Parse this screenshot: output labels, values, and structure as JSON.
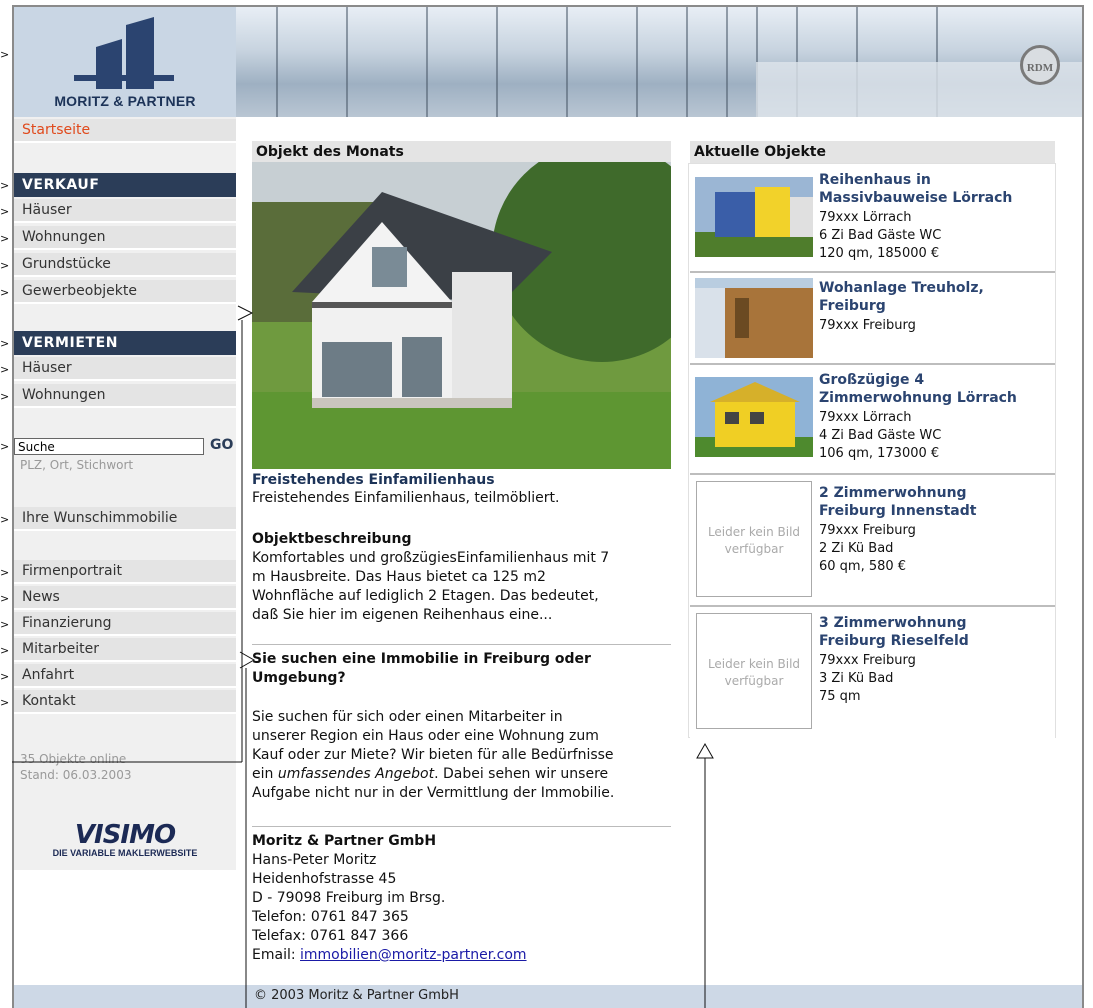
{
  "header": {
    "logo_text": "MORITZ & PARTNER",
    "badge_text": "RDM"
  },
  "sidebar": {
    "start": "Startseite",
    "verkauf_head": "VERKAUF",
    "verkauf_items": [
      "Häuser",
      "Wohnungen",
      "Grundstücke",
      "Gewerbeobjekte"
    ],
    "vermieten_head": "VERMIETEN",
    "vermieten_items": [
      "Häuser",
      "Wohnungen"
    ],
    "search_value": "Suche",
    "search_go": "GO",
    "search_hint": "PLZ, Ort, Stichwort",
    "wish": "Ihre Wunschimmobilie",
    "info_items": [
      "Firmenportrait",
      "News",
      "Finanzierung",
      "Mitarbeiter",
      "Anfahrt",
      "Kontakt"
    ],
    "objects_online": "35 Objekte online",
    "stand": "Stand: 06.03.2003",
    "visimo_logo": "VISIMO",
    "visimo_sub": "DIE VARIABLE MAKLERWEBSITE"
  },
  "main": {
    "heading": "Objekt des Monats",
    "object_title": "Freistehendes Einfamilienhaus",
    "object_sub": "Freistehendes Einfamilienhaus, teilmöbliert.",
    "desc_heading": "Objektbeschreibung",
    "desc_lines": [
      "Komfortables und großzügiesEinfamilienhaus mit 7",
      "m Hausbreite. Das Haus bietet ca 125 m2",
      "Wohnfläche auf lediglich 2 Etagen. Das bedeutet,",
      "daß Sie hier im eigenen Reihenhaus eine..."
    ],
    "search_heading_1": "Sie suchen eine Immobilie in Freiburg oder",
    "search_heading_2": "Umgebung?",
    "search_lines": [
      "Sie suchen für sich oder einen Mitarbeiter in",
      "unserer Region ein Haus oder eine Wohnung zum",
      "Kauf oder zur Miete? Wir bieten für alle Bedürfnisse"
    ],
    "search_line4_pre": "ein ",
    "search_line4_em": "umfassendes Angebot",
    "search_line4_post": ". Dabei sehen wir unsere",
    "search_line5": "Aufgabe nicht nur in der Vermittlung der Immobilie.",
    "company": "Moritz & Partner GmbH",
    "address_lines": [
      "Hans-Peter Moritz",
      "Heidenhofstrasse 45",
      "D - 79098 Freiburg im Brsg.",
      "Telefon: 0761 847 365",
      "Telefax: 0761 847 366"
    ],
    "email_label": "Email: ",
    "email": "immobilien@moritz-partner.com"
  },
  "right": {
    "heading": "Aktuelle Objekte",
    "no_image": "Leider kein Bild verfügbar",
    "objects": [
      {
        "title": [
          "Reihenhaus in",
          "Massivbauweise Lörrach"
        ],
        "lines": [
          "79xxx Lörrach",
          "6 Zi Bad Gäste WC",
          "120 qm, 185000 €"
        ]
      },
      {
        "title": [
          "Wohanlage Treuholz,",
          "Freiburg"
        ],
        "lines": [
          "79xxx Freiburg"
        ]
      },
      {
        "title": [
          "Großzügige 4",
          "Zimmerwohnung Lörrach"
        ],
        "lines": [
          "79xxx Lörrach",
          "4 Zi Bad Gäste WC",
          "106 qm, 173000 €"
        ]
      },
      {
        "title": [
          "2 Zimmerwohnung",
          "Freiburg Innenstadt"
        ],
        "lines": [
          "79xxx Freiburg",
          "2 Zi Kü Bad",
          "60 qm, 580 €"
        ]
      },
      {
        "title": [
          "3 Zimmerwohnung",
          "Freiburg Rieselfeld"
        ],
        "lines": [
          "79xxx Freiburg",
          "3 Zi Kü Bad",
          "75 qm"
        ]
      }
    ]
  },
  "footer": {
    "copyright": "© 2003 Moritz & Partner GmbH"
  },
  "colors": {
    "nav_head": "#2b3d58",
    "start_link": "#e04a1c",
    "object_title": "#2b4470",
    "footer_bg": "#cdd8e6"
  }
}
